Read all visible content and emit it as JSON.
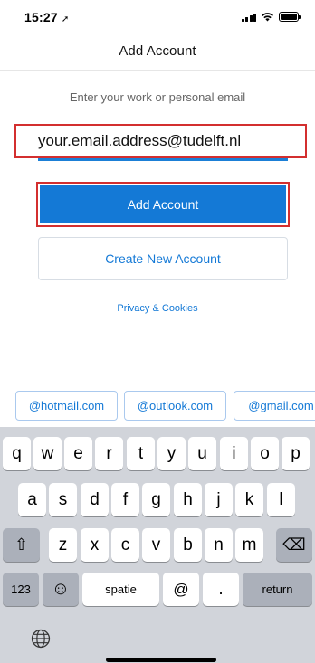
{
  "status_bar": {
    "time": "15:27",
    "location_glyph": "➚"
  },
  "header": {
    "title": "Add Account"
  },
  "form": {
    "prompt": "Enter your work or personal email",
    "email_value": "your.email.address@tudelft.nl",
    "primary_button": "Add Account",
    "secondary_button": "Create New Account",
    "privacy_link": "Privacy & Cookies"
  },
  "suggestions": [
    "@hotmail.com",
    "@outlook.com",
    "@gmail.com"
  ],
  "keyboard": {
    "row1": [
      "q",
      "w",
      "e",
      "r",
      "t",
      "y",
      "u",
      "i",
      "o",
      "p"
    ],
    "row2": [
      "a",
      "s",
      "d",
      "f",
      "g",
      "h",
      "j",
      "k",
      "l"
    ],
    "row3": [
      "z",
      "x",
      "c",
      "v",
      "b",
      "n",
      "m"
    ],
    "numbers_key": "123",
    "emoji_glyph": "☺",
    "space_key": "spatie",
    "at_key": "@",
    "dot_key": ".",
    "return_key": "return",
    "shift_glyph": "⇧",
    "delete_glyph": "⌫",
    "globe_glyph": "◍"
  },
  "colors": {
    "accent": "#1479d6",
    "highlight_border": "#d32f2f",
    "keyboard_bg": "#d1d4da"
  }
}
